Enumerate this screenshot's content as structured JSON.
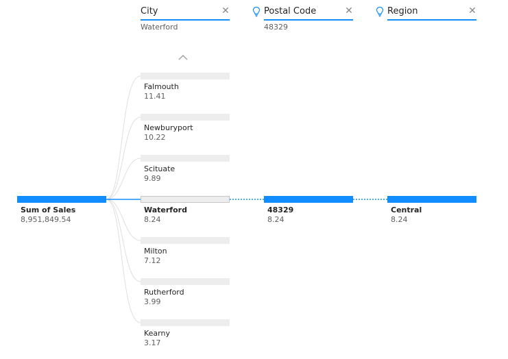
{
  "headers": {
    "city": {
      "title": "City",
      "selected": "Waterford"
    },
    "postal": {
      "title": "Postal Code",
      "selected": "48329"
    },
    "region": {
      "title": "Region",
      "selected": ""
    }
  },
  "root": {
    "label": "Sum of Sales",
    "value": "8,951,849.54"
  },
  "cities": [
    {
      "label": "Falmouth",
      "value": "11.41"
    },
    {
      "label": "Newburyport",
      "value": "10.22"
    },
    {
      "label": "Scituate",
      "value": "9.89"
    },
    {
      "label": "Waterford",
      "value": "8.24"
    },
    {
      "label": "Milton",
      "value": "7.12"
    },
    {
      "label": "Rutherford",
      "value": "3.99"
    },
    {
      "label": "Kearny",
      "value": "3.17"
    }
  ],
  "postal_node": {
    "label": "48329",
    "value": "8.24"
  },
  "region_node": {
    "label": "Central",
    "value": "8.24"
  },
  "colors": {
    "accent": "#118dff",
    "track": "#ededed",
    "connector": "#d6d6d6"
  },
  "icons": {
    "close": "close-icon",
    "bulb": "lightbulb-icon",
    "chevron": "chevron-up-icon"
  }
}
